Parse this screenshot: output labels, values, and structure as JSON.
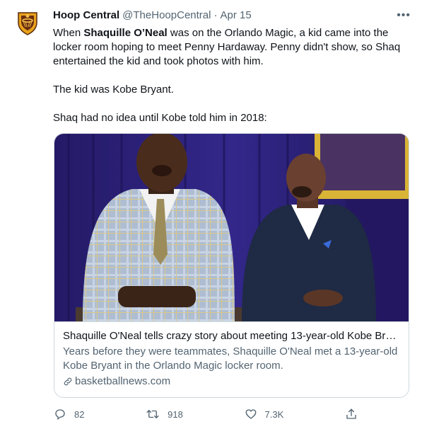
{
  "tweet": {
    "author_name": "Hoop Central",
    "handle": "@TheHoopCentral",
    "separator": "·",
    "date": "Apr 15",
    "more": "•••",
    "text": {
      "intro_before": "When ",
      "intro_bold": "Shaquille O’Neal",
      "intro_after": " was on the Orlando Magic, a kid came into the locker room hoping to meet Penny Hardaway. Penny didn't show, so Shaq entertained the kid and took photos with him.",
      "line2": "The kid was Kobe Bryant.",
      "line3": "Shaq had no idea until Kobe told him in 2018:"
    }
  },
  "card": {
    "title": "Shaquille O'Neal tells crazy story about meeting 13-year-old Kobe Brya...",
    "description": "Years before they were teammates, Shaquille O'Neal met a 13-year-old Kobe Bryant in the Orlando Magic locker room.",
    "domain": "basketballnews.com",
    "image": {
      "subject_left": "Shaquille O'Neal in a light plaid suit",
      "subject_right": "Kobe Bryant in a navy suit",
      "background": "purple curtain with a gold-framed portrait"
    }
  },
  "actions": {
    "replies": "82",
    "retweets": "918",
    "likes": "7.3K"
  },
  "colors": {
    "text_primary": "#0f1419",
    "text_secondary": "#536471",
    "border": "#cfd9de",
    "curtain": "#2a1f73",
    "frame_gold": "#d9b436"
  }
}
